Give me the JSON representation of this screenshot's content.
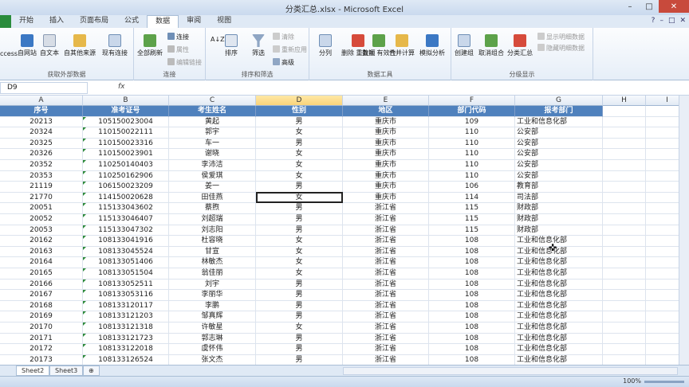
{
  "title": "分类汇总.xlsx - Microsoft Excel",
  "window_controls": {
    "minimize": "–",
    "maximize": "□",
    "close": "✕"
  },
  "tabs": [
    "开始",
    "插入",
    "页面布局",
    "公式",
    "数据",
    "审阅",
    "视图"
  ],
  "active_tab": "数据",
  "ribbon": {
    "get_external": {
      "label": "获取外部数据",
      "buttons": [
        "ccess",
        "自网站",
        "自文本",
        "自其他来源",
        "现有连接"
      ]
    },
    "connections": {
      "label": "连接",
      "refresh": "全部刷新",
      "items": [
        "连接",
        "属性",
        "编辑链接"
      ]
    },
    "sort_filter": {
      "label": "排序和筛选",
      "sort_az": "A↓Z",
      "sort": "排序",
      "filter": "筛选",
      "items": [
        "清除",
        "重新应用",
        "高级"
      ]
    },
    "data_tools": {
      "label": "数据工具",
      "buttons": [
        "分列",
        "删除\n重复项",
        "数据\n有效性",
        "合并计算",
        "模拟分析"
      ]
    },
    "outline": {
      "label": "分级显示",
      "buttons": [
        "创建组",
        "取消组合",
        "分类汇总"
      ],
      "items": [
        "显示明细数据",
        "隐藏明细数据"
      ]
    }
  },
  "formula_bar": {
    "name_box": "D9",
    "fx": "fx",
    "content": ""
  },
  "columns": [
    "A",
    "B",
    "C",
    "D",
    "E",
    "F",
    "G",
    "H",
    "I"
  ],
  "selected_column": "D",
  "header_row": [
    "序号",
    "准考证号",
    "考生姓名",
    "性别",
    "地区",
    "部门代码",
    "报考部门"
  ],
  "rows": [
    [
      "20213",
      "105150023004",
      "黄起",
      "男",
      "重庆市",
      "109",
      "工业和信息化部"
    ],
    [
      "20324",
      "110150022111",
      "郭宇",
      "女",
      "重庆市",
      "110",
      "公安部"
    ],
    [
      "20325",
      "110150023316",
      "车一",
      "男",
      "重庆市",
      "110",
      "公安部"
    ],
    [
      "20326",
      "110150023901",
      "谢晓",
      "女",
      "重庆市",
      "110",
      "公安部"
    ],
    [
      "20352",
      "110250140403",
      "李沛洁",
      "女",
      "重庆市",
      "110",
      "公安部"
    ],
    [
      "20353",
      "110250162906",
      "侯爱琪",
      "女",
      "重庆市",
      "110",
      "公安部"
    ],
    [
      "21119",
      "106150023209",
      "姜一",
      "男",
      "重庆市",
      "106",
      "教育部"
    ],
    [
      "21770",
      "114150020628",
      "田佳燕",
      "女",
      "重庆市",
      "114",
      "司法部"
    ],
    [
      "20051",
      "115133043602",
      "蔡煦",
      "男",
      "浙江省",
      "115",
      "财政部"
    ],
    [
      "20052",
      "115133046407",
      "刘超瑞",
      "男",
      "浙江省",
      "115",
      "财政部"
    ],
    [
      "20053",
      "115133047302",
      "刘志阳",
      "男",
      "浙江省",
      "115",
      "财政部"
    ],
    [
      "20162",
      "108133041916",
      "杜容晓",
      "女",
      "浙江省",
      "108",
      "工业和信息化部"
    ],
    [
      "20163",
      "108133045524",
      "甘宣",
      "女",
      "浙江省",
      "108",
      "工业和信息化部"
    ],
    [
      "20164",
      "108133051406",
      "林敏杰",
      "女",
      "浙江省",
      "108",
      "工业和信息化部"
    ],
    [
      "20165",
      "108133051504",
      "翁佳丽",
      "女",
      "浙江省",
      "108",
      "工业和信息化部"
    ],
    [
      "20166",
      "108133052511",
      "刘宇",
      "男",
      "浙江省",
      "108",
      "工业和信息化部"
    ],
    [
      "20167",
      "108133053116",
      "李丽华",
      "男",
      "浙江省",
      "108",
      "工业和信息化部"
    ],
    [
      "20168",
      "108133120117",
      "李鹏",
      "男",
      "浙江省",
      "108",
      "工业和信息化部"
    ],
    [
      "20169",
      "108133121203",
      "邹真辉",
      "男",
      "浙江省",
      "108",
      "工业和信息化部"
    ],
    [
      "20170",
      "108133121318",
      "许敏星",
      "女",
      "浙江省",
      "108",
      "工业和信息化部"
    ],
    [
      "20171",
      "108133121723",
      "郭志琳",
      "男",
      "浙江省",
      "108",
      "工业和信息化部"
    ],
    [
      "20172",
      "108133122018",
      "虞怀伟",
      "男",
      "浙江省",
      "108",
      "工业和信息化部"
    ],
    [
      "20173",
      "108133126524",
      "张文杰",
      "男",
      "浙江省",
      "108",
      "工业和信息化部"
    ]
  ],
  "sheet_tabs": [
    "Sheet2",
    "Sheet3"
  ],
  "active_sheet": "Sheet2",
  "zoom": "100%",
  "colors": {
    "header_fill": "#4f81bd",
    "selected_col": "#f9d37a",
    "file_tab": "#2a8c3c"
  }
}
